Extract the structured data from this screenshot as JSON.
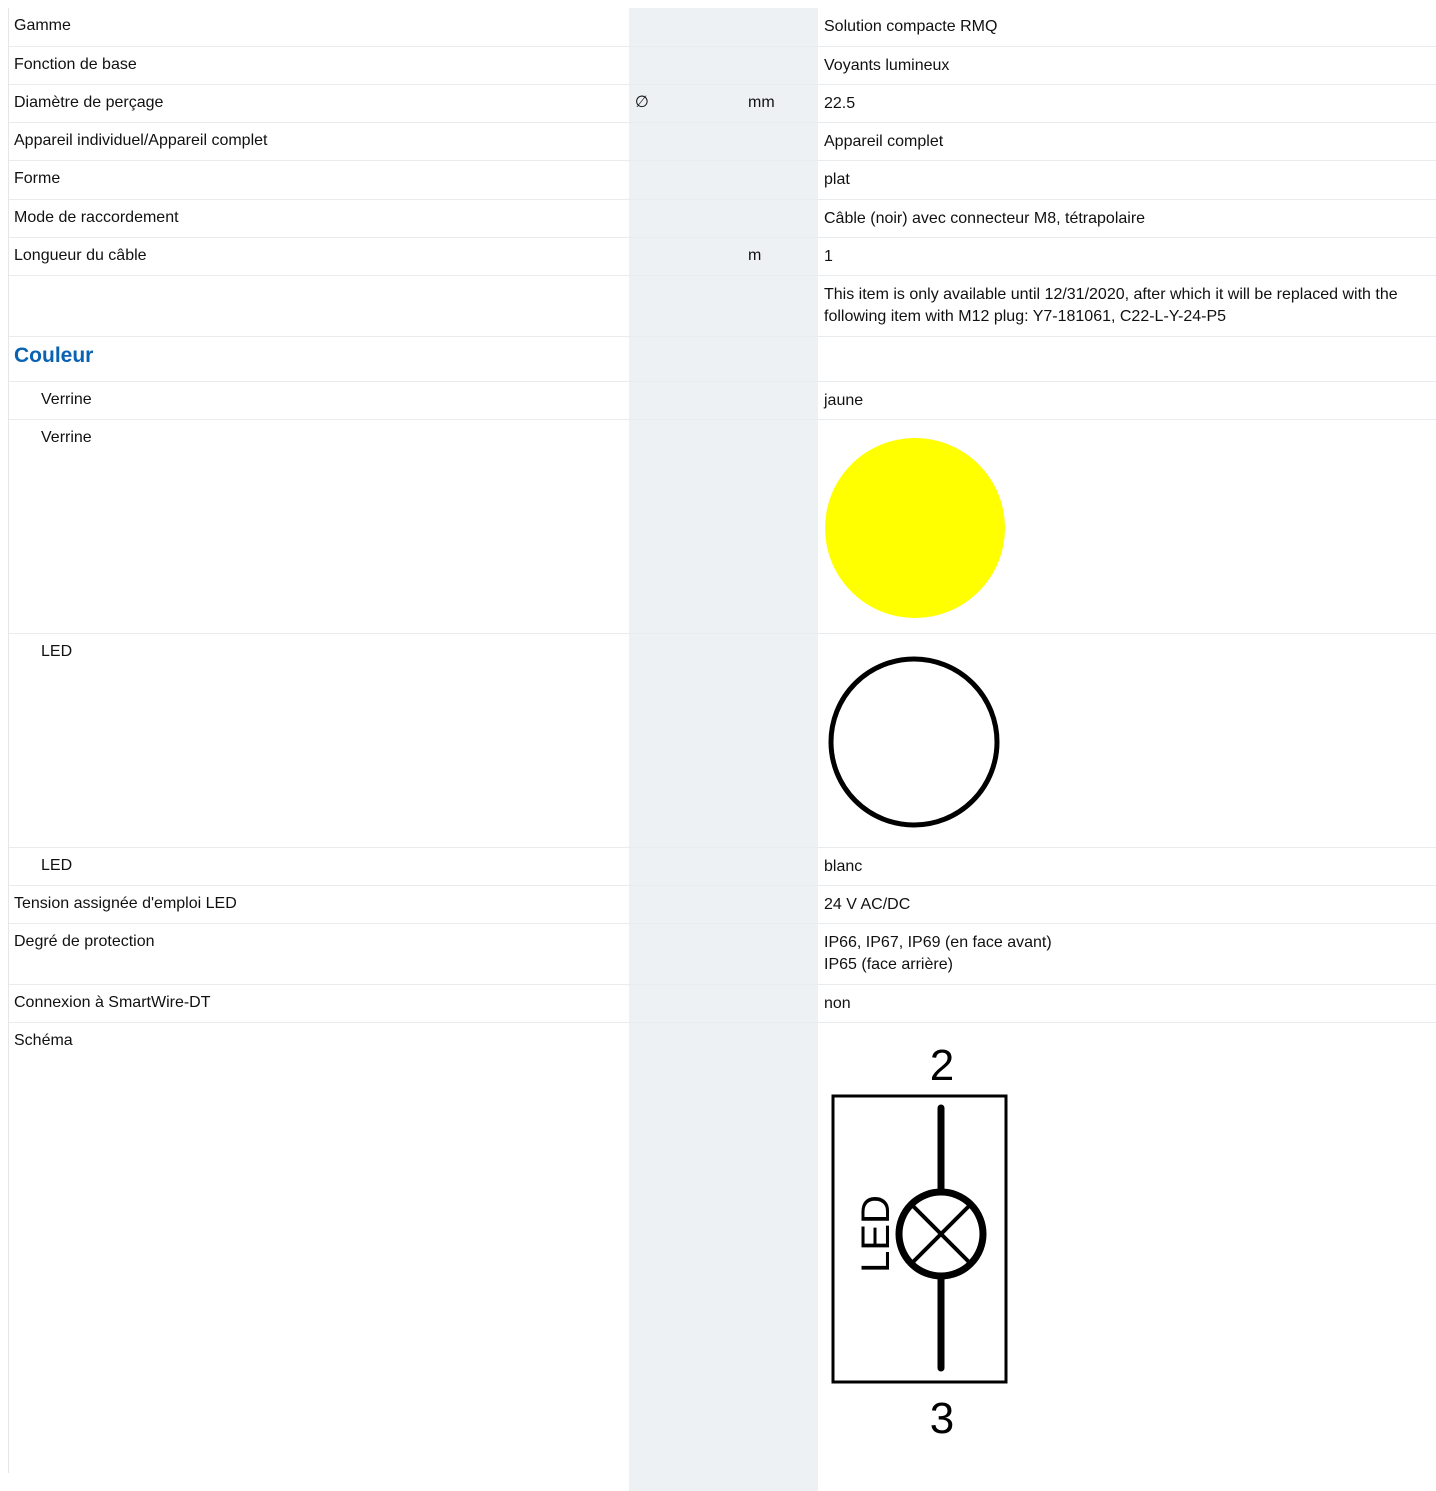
{
  "rows": [
    {
      "label": "Gamme",
      "symbol": "",
      "unit": "",
      "value": "Solution compacte RMQ"
    },
    {
      "label": "Fonction de base",
      "symbol": "",
      "unit": "",
      "value": "Voyants lumineux"
    },
    {
      "label": "Diamètre de perçage",
      "symbol": "∅",
      "unit": "mm",
      "value": "22.5"
    },
    {
      "label": "Appareil individuel/Appareil complet",
      "symbol": "",
      "unit": "",
      "value": "Appareil complet"
    },
    {
      "label": "Forme",
      "symbol": "",
      "unit": "",
      "value": "plat"
    },
    {
      "label": "Mode de raccordement",
      "symbol": "",
      "unit": "",
      "value": "Câble (noir) avec connecteur M8, tétrapolaire"
    },
    {
      "label": "Longueur du câble",
      "symbol": "",
      "unit": "m",
      "value": "1"
    }
  ],
  "note": "This item is only available until 12/31/2020, after which it will be replaced with the following item with M12 plug: Y7-181061, C22-L-Y-24-P5",
  "section_couleur": "Couleur",
  "color_rows": {
    "verrine_text_label": "Verrine",
    "verrine_text_value": "jaune",
    "verrine_swatch_label": "Verrine",
    "verrine_swatch_color": "#ffff00",
    "led_swatch_label": "LED",
    "led_swatch_color": "#ffffff",
    "led_text_label": "LED",
    "led_text_value": "blanc"
  },
  "rows2": [
    {
      "label": "Tension assignée d'emploi LED",
      "value": "24 V AC/DC"
    },
    {
      "label": "Degré de protection",
      "value_lines": [
        "IP66, IP67, IP69 (en face avant)",
        "IP65 (face arrière)"
      ]
    },
    {
      "label": "Connexion à SmartWire-DT",
      "value": "non"
    }
  ],
  "schema": {
    "label": "Schéma",
    "terminal_top": "2",
    "terminal_bottom": "3",
    "component_text": "LED"
  }
}
